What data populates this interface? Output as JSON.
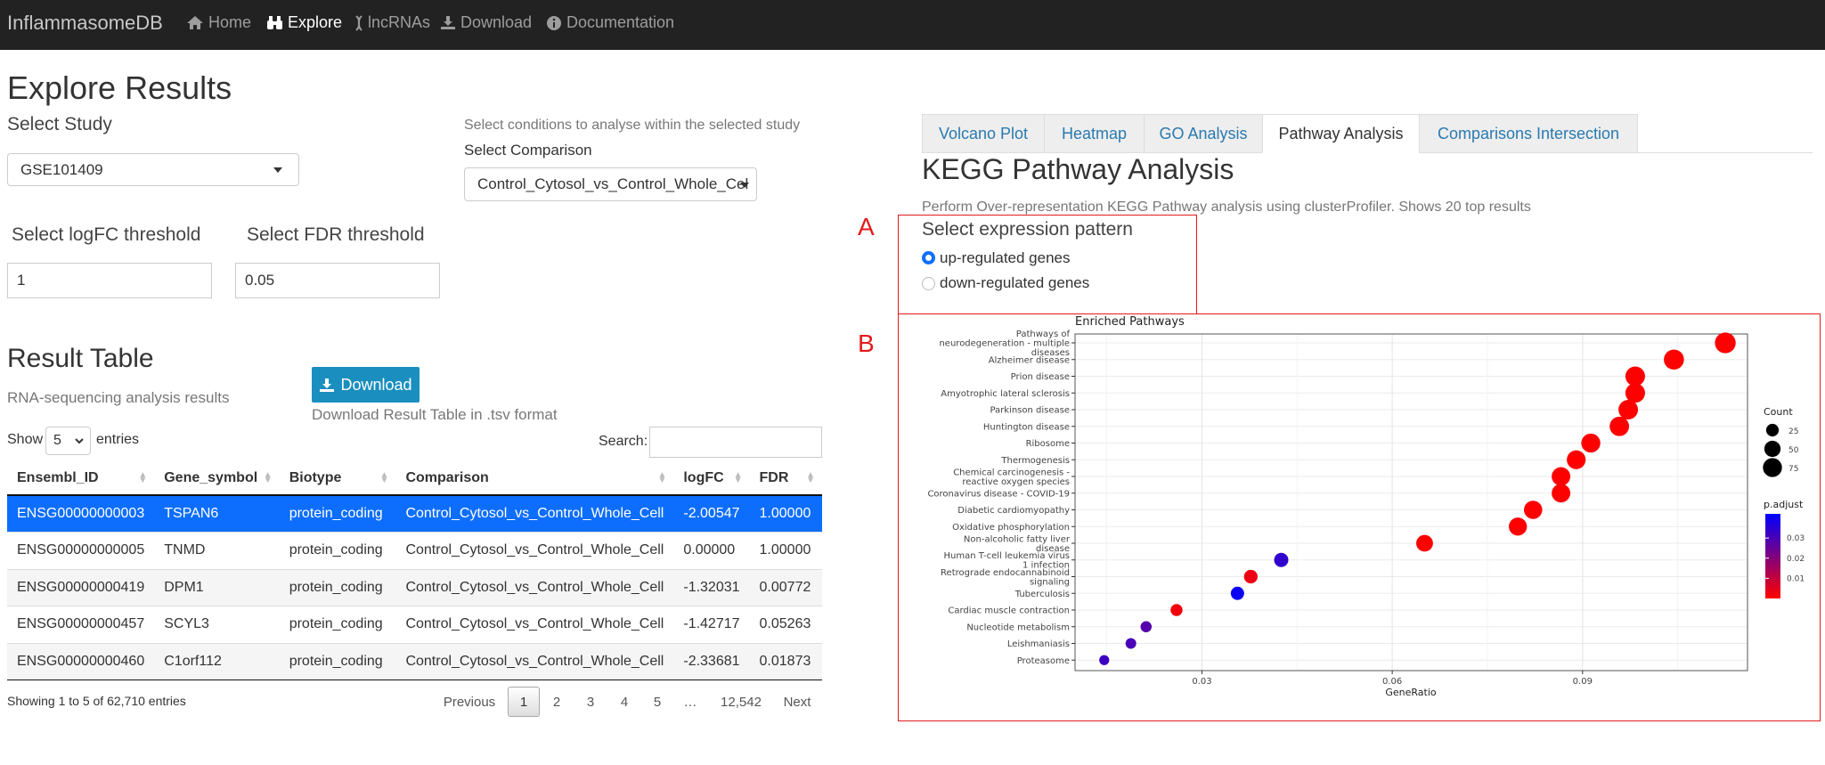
{
  "navbar": {
    "brand": "InflammasomeDB",
    "items": [
      {
        "label": "Home",
        "icon": "home-icon",
        "active": false
      },
      {
        "label": "Explore",
        "icon": "binoculars-icon",
        "active": true
      },
      {
        "label": "lncRNAs",
        "icon": "dna-icon",
        "active": false
      },
      {
        "label": "Download",
        "icon": "download-icon",
        "active": false
      },
      {
        "label": "Documentation",
        "icon": "info-circle-icon",
        "active": false
      }
    ]
  },
  "page_title": "Explore Results",
  "study": {
    "label": "Select Study",
    "value": "GSE101409"
  },
  "comparison": {
    "hint": "Select conditions to analyse within the selected study",
    "label": "Select Comparison",
    "value": "Control_Cytosol_vs_Control_Whole_Cel"
  },
  "thresholds": {
    "logfc_label": "Select logFC threshold",
    "logfc_value": "1",
    "fdr_label": "Select FDR threshold",
    "fdr_value": "0.05"
  },
  "result_table": {
    "title": "Result Table",
    "subtitle": "RNA-sequencing analysis results",
    "download_label": "Download",
    "download_hint": "Download Result Table in .tsv format",
    "show_label": "Show",
    "page_size": "5",
    "entries_label": "entries",
    "search_label": "Search:",
    "search_value": "",
    "columns": [
      "Ensembl_ID",
      "Gene_symbol",
      "Biotype",
      "Comparison",
      "logFC",
      "FDR"
    ],
    "rows": [
      [
        "ENSG00000000003",
        "TSPAN6",
        "protein_coding",
        "Control_Cytosol_vs_Control_Whole_Cell",
        "-2.00547",
        "1.00000"
      ],
      [
        "ENSG00000000005",
        "TNMD",
        "protein_coding",
        "Control_Cytosol_vs_Control_Whole_Cell",
        "0.00000",
        "1.00000"
      ],
      [
        "ENSG00000000419",
        "DPM1",
        "protein_coding",
        "Control_Cytosol_vs_Control_Whole_Cell",
        "-1.32031",
        "0.00772"
      ],
      [
        "ENSG00000000457",
        "SCYL3",
        "protein_coding",
        "Control_Cytosol_vs_Control_Whole_Cell",
        "-1.42717",
        "0.05263"
      ],
      [
        "ENSG00000000460",
        "C1orf112",
        "protein_coding",
        "Control_Cytosol_vs_Control_Whole_Cell",
        "-2.33681",
        "0.01873"
      ]
    ],
    "info": "Showing 1 to 5 of 62,710 entries",
    "pagination": {
      "previous": "Previous",
      "pages": [
        "1",
        "2",
        "3",
        "4",
        "5",
        "…",
        "12,542"
      ],
      "current": "1",
      "next": "Next"
    }
  },
  "tabs": [
    "Volcano Plot",
    "Heatmap",
    "GO Analysis",
    "Pathway Analysis",
    "Comparisons Intersection"
  ],
  "active_tab": "Pathway Analysis",
  "pathway": {
    "title": "KEGG Pathway Analysis",
    "description": "Perform Over-representation KEGG Pathway analysis using clusterProfiler. Shows 20 top results",
    "pattern_label": "Select expression pattern",
    "options": [
      {
        "label": "up-regulated genes",
        "selected": true
      },
      {
        "label": "down-regulated genes",
        "selected": false
      }
    ]
  },
  "annotations": {
    "a": "A",
    "b": "B",
    "color": "#e31a1c"
  },
  "chart_data": {
    "type": "scatter",
    "title": "Enriched Pathways",
    "xlabel": "GeneRatio",
    "ylabel": "",
    "xlim": [
      0.01,
      0.116
    ],
    "xticks": [
      0.03,
      0.06,
      0.09
    ],
    "xtick_labels": [
      "0.03",
      "0.06",
      "0.09"
    ],
    "grid": true,
    "categories": [
      "Pathways of\nneurodegeneration - multiple\ndiseases",
      "Alzheimer disease",
      "Prion disease",
      "Amyotrophic lateral sclerosis",
      "Parkinson disease",
      "Huntington disease",
      "Ribosome",
      "Thermogenesis",
      "Chemical carcinogenesis -\nreactive oxygen species",
      "Coronavirus disease - COVID-19",
      "Diabetic cardiomyopathy",
      "Oxidative phosphorylation",
      "Non-alcoholic fatty liver\ndisease",
      "Human T-cell leukemia virus\n1 infection",
      "Retrograde endocannabinoid\nsignaling",
      "Tuberculosis",
      "Cardiac muscle contraction",
      "Nucleotide metabolism",
      "Leishmaniasis",
      "Proteasome"
    ],
    "gene_ratio": [
      0.1125,
      0.1044,
      0.0983,
      0.0983,
      0.0972,
      0.0958,
      0.0913,
      0.089,
      0.0866,
      0.0866,
      0.0822,
      0.0798,
      0.0651,
      0.0425,
      0.0377,
      0.0356,
      0.026,
      0.0212,
      0.0188,
      0.0146
    ],
    "count": [
      93,
      86,
      81,
      81,
      80,
      79,
      75,
      73,
      71,
      71,
      68,
      66,
      54,
      35,
      31,
      29,
      21,
      17,
      15,
      12
    ],
    "p_adjust": [
      0.0,
      0.0,
      0.0,
      0.0,
      0.0,
      0.0,
      0.0,
      0.0,
      0.0,
      0.0,
      0.0,
      0.0,
      0.0,
      0.034,
      0.003,
      0.04,
      0.002,
      0.028,
      0.03,
      0.032
    ],
    "legend": {
      "placement": "right",
      "size_title": "Count",
      "size_values": [
        25,
        50,
        75
      ],
      "color_title": "p.adjust",
      "color_ticks": [
        0.03,
        0.02,
        0.01
      ],
      "color_tick_labels": [
        "0.03",
        "0.02",
        "0.01"
      ],
      "color_low": "#ff0000",
      "color_high": "#0000ff"
    }
  }
}
